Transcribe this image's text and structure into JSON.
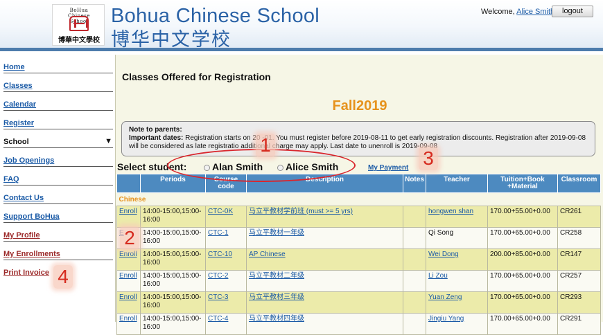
{
  "header": {
    "logo_arc_text": "BoHua Chinese School",
    "logo_text": "博華中文學校",
    "title_en": "Bohua Chinese School",
    "title_cn": "博华中文学校",
    "welcome_prefix": "Welcome,",
    "user_name": "Alice Smith",
    "logout_label": "logout"
  },
  "sidebar": {
    "items": [
      {
        "label": "Home"
      },
      {
        "label": "Classes"
      },
      {
        "label": "Calendar"
      },
      {
        "label": "Register"
      },
      {
        "label": "School"
      },
      {
        "label": "Job Openings"
      },
      {
        "label": "FAQ"
      },
      {
        "label": "Contact Us"
      },
      {
        "label": "Support BoHua"
      },
      {
        "label": "My Profile"
      },
      {
        "label": "My Enrollments"
      },
      {
        "label": "Print Invoice"
      }
    ],
    "caret": "▼"
  },
  "main": {
    "page_title": "Classes Offered for Registration",
    "term": "Fall2019",
    "note": {
      "heading": "Note to parents:",
      "dates_label": "Important dates:",
      "text": " Registration starts on 20    -01. You must register before 2019-08-11 to get early registration discounts. Registration after 2019-09-08 will be considered as late registratio     additional charge may apply. Last date to unenroll is 2019-09-08"
    },
    "select_label": "Select student:",
    "students": [
      "Alan Smith",
      "Alice Smith"
    ],
    "my_payment": "My Payment"
  },
  "table": {
    "headers": [
      "",
      "Periods",
      "Course code",
      "Description",
      "Notes",
      "Teacher",
      "Tuition+Book +Material",
      "Classroom"
    ],
    "category": "Chinese",
    "rows": [
      {
        "action": "Enroll",
        "period": "14:00-15:00,15:00-16:00",
        "code": "CTC-0K",
        "desc": "马立平教材学前班 (must >= 5 yrs)",
        "notes": "",
        "teacher": "hongwen shan",
        "teacher_link": true,
        "tuition": "170.00+55.00+0.00",
        "room": "CR261"
      },
      {
        "action": "E",
        "period": "14:00-15:00,15:00-16:00",
        "code": "CTC-1",
        "desc": "马立平教材一年级",
        "notes": "",
        "teacher": "Qi Song",
        "teacher_link": false,
        "tuition": "170.00+65.00+0.00",
        "room": "CR258"
      },
      {
        "action": "Enroll",
        "period": "14:00-15:00,15:00-16:00",
        "code": "CTC-10",
        "desc": "AP Chinese",
        "notes": "",
        "teacher": "Wei Dong",
        "teacher_link": true,
        "tuition": "200.00+85.00+0.00",
        "room": "CR147"
      },
      {
        "action": "Enroll",
        "period": "14:00-15:00,15:00-16:00",
        "code": "CTC-2",
        "desc": "马立平教材二年级",
        "notes": "",
        "teacher": "Li Zou",
        "teacher_link": true,
        "tuition": "170.00+65.00+0.00",
        "room": "CR257"
      },
      {
        "action": "Enroll",
        "period": "14:00-15:00,15:00-16:00",
        "code": "CTC-3",
        "desc": "马立平教材三年级",
        "notes": "",
        "teacher": "Yuan Zeng",
        "teacher_link": true,
        "tuition": "170.00+65.00+0.00",
        "room": "CR293"
      },
      {
        "action": "Enroll",
        "period": "14:00-15:00,15:00-16:00",
        "code": "CTC-4",
        "desc": "马立平教材四年级",
        "notes": "",
        "teacher": "Jingiu Yang",
        "teacher_link": true,
        "tuition": "170.00+65.00+0.00",
        "room": "CR291"
      }
    ]
  },
  "annotations": {
    "n1": "1",
    "n2": "2",
    "n3": "3",
    "n4": "4"
  },
  "colors": {
    "header_bar": "#4d7cac",
    "table_header": "#4d8ac0",
    "term_orange": "#e6921c",
    "row_yellow": "#ecebaa",
    "annotation_red": "#d62b1f"
  }
}
